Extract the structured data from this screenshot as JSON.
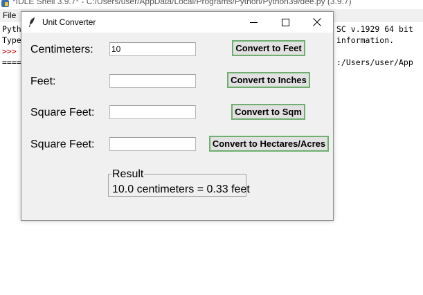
{
  "background_window": {
    "title": "*IDLE Shell 3.9.7* - C:/Users/user/AppData/Local/Programs/Python/Python39/dee.py (3.9.7)",
    "menu_file": "File",
    "shell_lines_left": [
      "Pyth",
      "Type",
      ">>>",
      "===="
    ],
    "shell_lines_right": [
      "SC v.1929 64 bit",
      "information.",
      "",
      ":/Users/user/App"
    ]
  },
  "window": {
    "title": "Unit Converter",
    "icons": {
      "app": "feather-icon",
      "minimize": "minimize-icon",
      "maximize": "maximize-icon",
      "close": "close-icon"
    }
  },
  "rows": [
    {
      "label": "Centimeters:",
      "value": "10",
      "button": "Convert to Feet"
    },
    {
      "label": "Feet:",
      "value": "",
      "button": "Convert to Inches"
    },
    {
      "label": "Square Feet:",
      "value": "",
      "button": "Convert to Sqm"
    },
    {
      "label": "Square Feet:",
      "value": "",
      "button": "Convert to Hectares/Acres"
    }
  ],
  "result": {
    "legend": "Result",
    "text": "10.0 centimeters = 0.33 feet"
  },
  "colors": {
    "button_border": "#6fae6f",
    "window_bg": "#f0f0f0",
    "prompt": "#c00000"
  }
}
